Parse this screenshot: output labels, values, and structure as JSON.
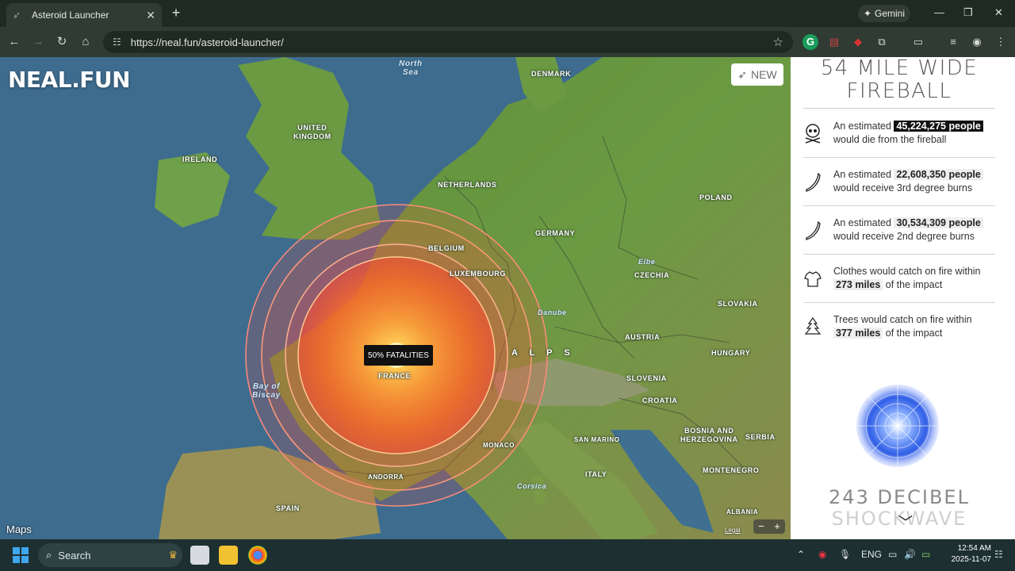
{
  "browser": {
    "tab_title": "Asteroid Launcher",
    "tab_close": "✕",
    "new_tab": "+",
    "gemini_label": "Gemini",
    "url": "https://neal.fun/asteroid-launcher/",
    "window_controls": [
      "—",
      "❐",
      "✕"
    ]
  },
  "map": {
    "logo": "NEAL.FUN",
    "new_button": "NEW",
    "fatality_label": "50% FATALITIES",
    "maps_credit": "Maps",
    "legal": "Legal",
    "zoom_out": "−",
    "zoom_in": "+",
    "labels": {
      "north_sea": "North\nSea",
      "denmark": "DENMARK",
      "united_kingdom": "UNITED\nKINGDOM",
      "ireland": "IRELAND",
      "netherlands": "NETHERLANDS",
      "poland": "POLAND",
      "germany": "GERMANY",
      "belgium": "BELGIUM",
      "luxembourg": "LUXEMBOURG",
      "czechia": "CZECHIA",
      "elbe": "Elbe",
      "danube": "Danube",
      "slovakia": "SLOVAKIA",
      "austria": "AUSTRIA",
      "hungary": "HUNGARY",
      "alps": "A L P S",
      "slovenia": "SLOVENIA",
      "croatia": "CROATIA",
      "france": "FRANCE",
      "bay_of_biscay": "Bay of\nBiscay",
      "monaco": "MONACO",
      "san_marino": "SAN MARINO",
      "bosnia": "BOSNIA AND\nHERZEGOVINA",
      "serbia": "SERBIA",
      "montenegro": "MONTENEGRO",
      "andorra": "ANDORRA",
      "corsica": "Corsica",
      "italy": "ITALY",
      "spain": "SPAIN",
      "albania": "ALBANIA"
    }
  },
  "panel": {
    "fireball_title_line1": "54 MILE WIDE",
    "fireball_title_line2": "FIREBALL",
    "items": [
      {
        "icon": "skull-icon",
        "prefix": "An estimated",
        "value": "45,224,275 people",
        "suffix": "would die from the fireball"
      },
      {
        "icon": "burn-icon",
        "prefix": "An estimated",
        "value": "22,608,350 people",
        "suffix": "would receive 3rd degree burns"
      },
      {
        "icon": "burn-icon",
        "prefix": "An estimated",
        "value": "30,534,309 people",
        "suffix": "would receive 2nd degree burns"
      },
      {
        "icon": "shirt-icon",
        "prefix": "Clothes would catch on fire within",
        "value": "273 miles",
        "suffix": "of the impact"
      },
      {
        "icon": "tree-icon",
        "prefix": "Trees would catch on fire within",
        "value": "377 miles",
        "suffix": "of the impact"
      }
    ],
    "shockwave_title_line1": "243 DECIBEL",
    "shockwave_title_line2": "SHOCKWAVE"
  },
  "taskbar": {
    "search_label": "Search",
    "language": "ENG",
    "time": "12:54 AM",
    "date": "2025-11-07"
  },
  "colors": {
    "fireball_core": "#ffb347",
    "fireball_outer": "#ff5a1f",
    "ring": "#ff9a6a",
    "panel_bg": "#ffffff",
    "highlight_dark": "#111111"
  }
}
